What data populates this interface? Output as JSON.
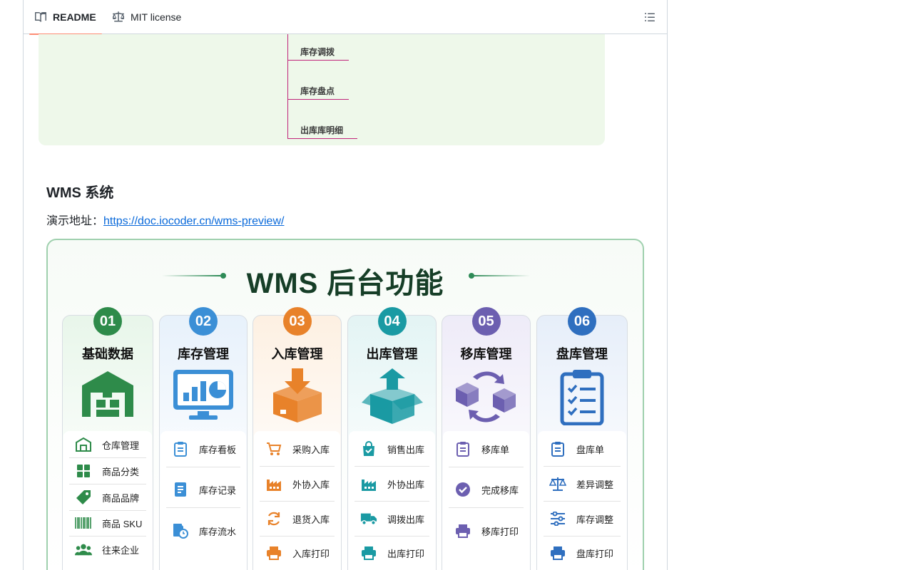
{
  "tabs": {
    "readme": "README",
    "license": "MIT license"
  },
  "mindmap": {
    "items": [
      "库存调拨",
      "库存盘点",
      "出库库明细"
    ]
  },
  "section": {
    "title": "WMS 系统",
    "demo_label": "演示地址：",
    "demo_url": "https://doc.iocoder.cn/wms-preview/"
  },
  "poster": {
    "title": "WMS 后台功能",
    "accent": "#2e8b57",
    "columns": [
      {
        "num": "01",
        "title": "基础数据",
        "color": "#2e8b4a",
        "items": [
          "仓库管理",
          "商品分类",
          "商品品牌",
          "商品 SKU",
          "往来企业"
        ]
      },
      {
        "num": "02",
        "title": "库存管理",
        "color": "#3b8fd6",
        "items": [
          "库存看板",
          "库存记录",
          "库存流水"
        ]
      },
      {
        "num": "03",
        "title": "入库管理",
        "color": "#e8822a",
        "items": [
          "采购入库",
          "外协入库",
          "退货入库",
          "入库打印"
        ]
      },
      {
        "num": "04",
        "title": "出库管理",
        "color": "#1a9aa3",
        "items": [
          "销售出库",
          "外协出库",
          "调拨出库",
          "出库打印"
        ]
      },
      {
        "num": "05",
        "title": "移库管理",
        "color": "#6c5fb0",
        "items": [
          "移库单",
          "完成移库",
          "移库打印"
        ]
      },
      {
        "num": "06",
        "title": "盘库管理",
        "color": "#2f6fbf",
        "items": [
          "盘库单",
          "差异调整",
          "库存调整",
          "盘库打印"
        ]
      }
    ]
  }
}
